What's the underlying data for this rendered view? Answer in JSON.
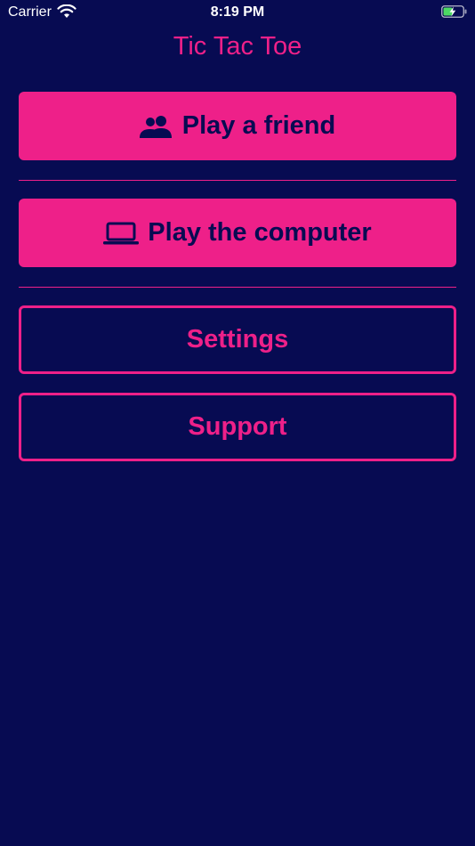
{
  "status_bar": {
    "carrier": "Carrier",
    "time": "8:19 PM",
    "wifi_icon": "wifi-icon",
    "battery_icon": "battery-charging-icon"
  },
  "app": {
    "title": "Tic Tac Toe"
  },
  "menu": {
    "play_friend": {
      "label": "Play a friend",
      "icon": "people-icon"
    },
    "play_computer": {
      "label": "Play the computer",
      "icon": "laptop-icon"
    },
    "settings": {
      "label": "Settings"
    },
    "support": {
      "label": "Support"
    }
  },
  "colors": {
    "background": "#070b52",
    "accent": "#ee2089"
  }
}
